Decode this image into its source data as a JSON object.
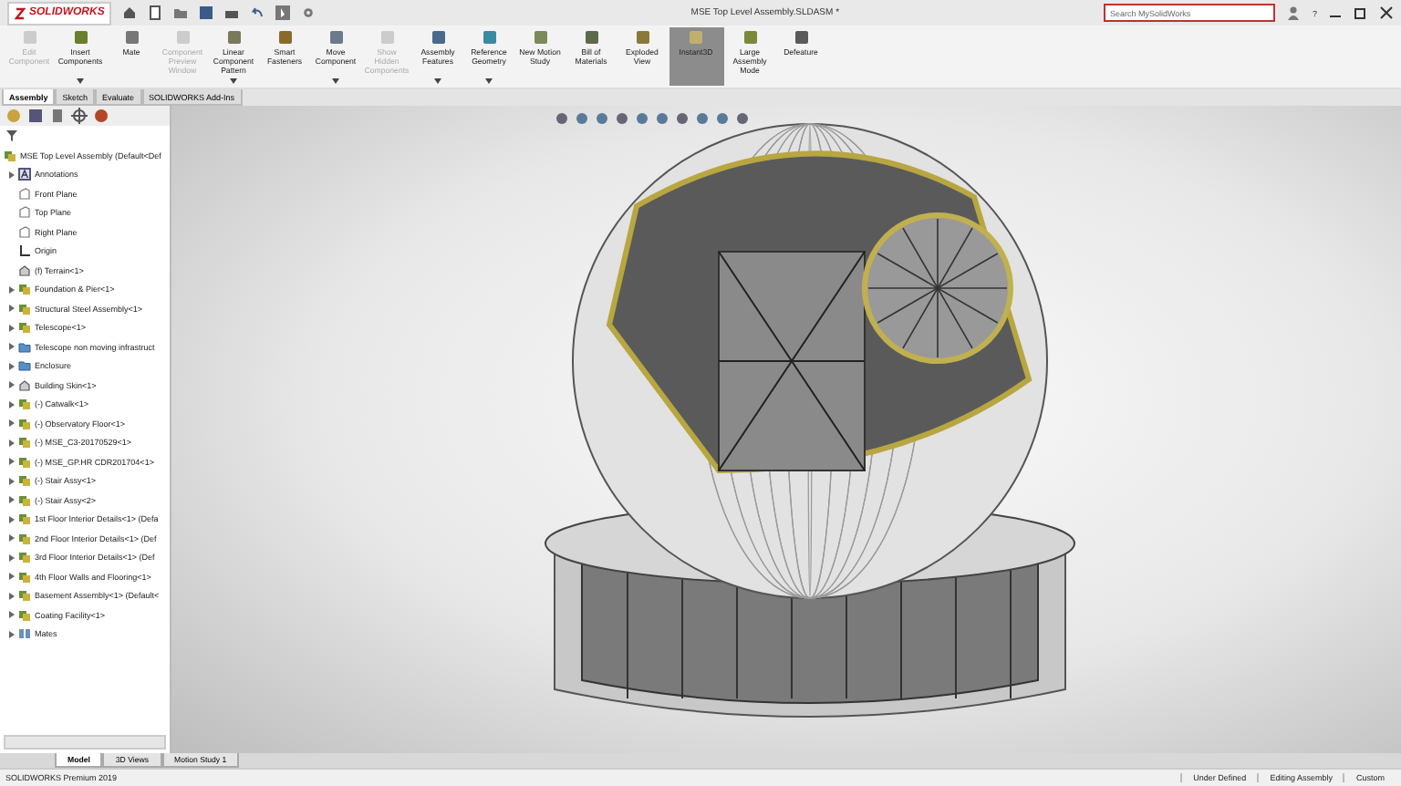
{
  "app": {
    "logo": "SOLIDWORKS",
    "title": "MSE Top Level Assembly.SLDASM *",
    "search": {
      "placeholder": "Search MySolidWorks"
    },
    "help": "?"
  },
  "ribbon": [
    {
      "label": "Edit Component",
      "disabled": true,
      "dropdown": false,
      "selected": false
    },
    {
      "label": "Insert Components",
      "disabled": false,
      "dropdown": true,
      "selected": false
    },
    {
      "label": "Mate",
      "disabled": false,
      "dropdown": false,
      "selected": false
    },
    {
      "label": "Component Preview Window",
      "disabled": true,
      "dropdown": false,
      "selected": false
    },
    {
      "label": "Linear Component Pattern",
      "disabled": false,
      "dropdown": true,
      "selected": false
    },
    {
      "label": "Smart Fasteners",
      "disabled": false,
      "dropdown": false,
      "selected": false
    },
    {
      "label": "Move Component",
      "disabled": false,
      "dropdown": true,
      "selected": false
    },
    {
      "label": "Show Hidden Components",
      "disabled": true,
      "dropdown": false,
      "selected": false
    },
    {
      "label": "Assembly Features",
      "disabled": false,
      "dropdown": true,
      "selected": false
    },
    {
      "label": "Reference Geometry",
      "disabled": false,
      "dropdown": true,
      "selected": false
    },
    {
      "label": "New Motion Study",
      "disabled": false,
      "dropdown": false,
      "selected": false
    },
    {
      "label": "Bill of Materials",
      "disabled": false,
      "dropdown": false,
      "selected": false
    },
    {
      "label": "Exploded View",
      "disabled": false,
      "dropdown": false,
      "selected": false
    },
    {
      "label": "Instant3D",
      "disabled": false,
      "dropdown": false,
      "selected": true
    },
    {
      "label": "Large Assembly Mode",
      "disabled": false,
      "dropdown": false,
      "selected": false
    },
    {
      "label": "Defeature",
      "disabled": false,
      "dropdown": false,
      "selected": false
    }
  ],
  "tabs": [
    {
      "label": "Assembly",
      "selected": true
    },
    {
      "label": "Sketch",
      "selected": false
    },
    {
      "label": "Evaluate",
      "selected": false
    },
    {
      "label": "SOLIDWORKS Add-Ins",
      "selected": false
    }
  ],
  "tree": {
    "root": "MSE Top Level Assembly  (Default<Def",
    "children": [
      {
        "label": "Annotations",
        "kind": "annotations",
        "expandable": true
      },
      {
        "label": "Front Plane",
        "kind": "plane",
        "expandable": false
      },
      {
        "label": "Top Plane",
        "kind": "plane",
        "expandable": false
      },
      {
        "label": "Right Plane",
        "kind": "plane",
        "expandable": false
      },
      {
        "label": "Origin",
        "kind": "origin",
        "expandable": false
      },
      {
        "label": "(f) Terrain<1>",
        "kind": "part",
        "expandable": false
      },
      {
        "label": "Foundation & Pier<1>",
        "kind": "assembly",
        "expandable": true
      },
      {
        "label": "Structural Steel Assembly<1>",
        "kind": "assembly",
        "expandable": true
      },
      {
        "label": "Telescope<1>",
        "kind": "assembly",
        "expandable": true
      },
      {
        "label": "Telescope non moving infrastruct",
        "kind": "folder",
        "expandable": true
      },
      {
        "label": "Enclosure",
        "kind": "folder",
        "expandable": true
      },
      {
        "label": "Building Skin<1>",
        "kind": "part",
        "expandable": true
      },
      {
        "label": "(-) Catwalk<1>",
        "kind": "assembly",
        "expandable": true
      },
      {
        "label": "(-) Observatory Floor<1>",
        "kind": "assembly",
        "expandable": true
      },
      {
        "label": "(-) MSE_C3-20170529<1>",
        "kind": "assembly",
        "expandable": true
      },
      {
        "label": "(-) MSE_GP.HR CDR201704<1>",
        "kind": "assembly",
        "expandable": true
      },
      {
        "label": "(-) Stair Assy<1>",
        "kind": "assembly",
        "expandable": true
      },
      {
        "label": "(-) Stair Assy<2>",
        "kind": "assembly",
        "expandable": true
      },
      {
        "label": "1st Floor Interior Details<1> (Defa",
        "kind": "assembly",
        "expandable": true
      },
      {
        "label": "2nd Floor Interior Details<1> (Def",
        "kind": "assembly",
        "expandable": true
      },
      {
        "label": "3rd Floor Interior Details<1> (Def",
        "kind": "assembly",
        "expandable": true
      },
      {
        "label": "4th Floor Walls and Flooring<1>",
        "kind": "assembly",
        "expandable": true
      },
      {
        "label": "Basement Assembly<1> (Default<",
        "kind": "assembly",
        "expandable": true
      },
      {
        "label": "Coating Facility<1>",
        "kind": "assembly",
        "expandable": true
      },
      {
        "label": "Mates",
        "kind": "mates",
        "expandable": true
      }
    ]
  },
  "bottom_tabs": [
    {
      "label": "Model",
      "selected": true
    },
    {
      "label": "3D Views",
      "selected": false
    },
    {
      "label": "Motion Study 1",
      "selected": false
    }
  ],
  "status_bar": {
    "product": "SOLIDWORKS Premium 2019",
    "fields": [
      "Under Defined",
      "Editing Assembly",
      "Custom"
    ]
  }
}
